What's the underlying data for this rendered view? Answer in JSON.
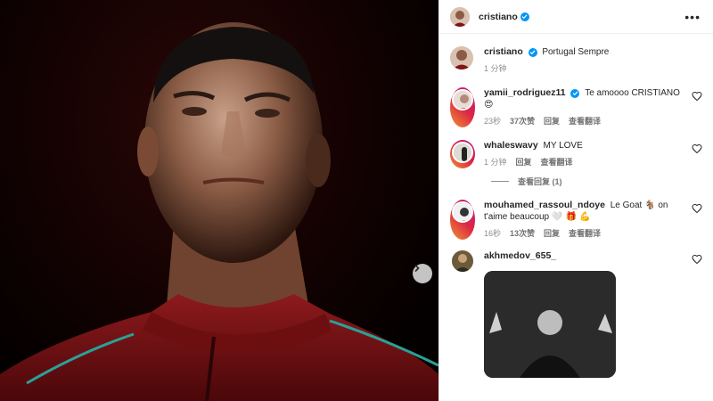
{
  "post": {
    "author": "cristiano",
    "caption": "Portugal Sempre",
    "time": "1 分钟",
    "more_label": "•••"
  },
  "comments": [
    {
      "user": "yamii_rodriguez11",
      "verified": true,
      "text": "Te amoooo CRISTIANO",
      "emoji": "😍",
      "time": "23秒",
      "likes": "37次赞",
      "reply": "回复",
      "translate": "查看翻译"
    },
    {
      "user": "whaleswavy",
      "text": "MY LOVE",
      "time": "1 分钟",
      "reply": "回复",
      "translate": "查看翻译",
      "view_replies": "查看回复 (1)"
    },
    {
      "user": "mouhamed_rassoul_ndoye",
      "text": "Le Goat",
      "text2": "on t'aime beaucoup",
      "emoji1": "🐐",
      "emoji2": "🤍 🎁 💪",
      "time": "16秒",
      "likes": "13次赞",
      "reply": "回复",
      "translate": "查看翻译"
    },
    {
      "user": "akhmedov_655_"
    }
  ],
  "icons": {
    "more": "more-icon",
    "verified": "verified-icon",
    "heart": "heart-icon",
    "next": "chevron-right-icon"
  },
  "colors": {
    "verified": "#0095f6",
    "jersey": "#7d1417"
  }
}
